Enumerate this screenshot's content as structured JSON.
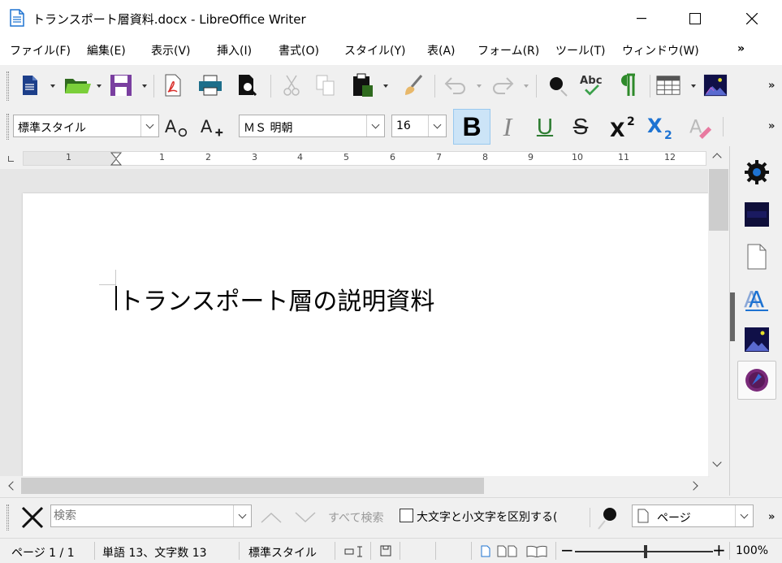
{
  "window": {
    "title": "トランスポート層資料.docx - LibreOffice Writer",
    "minimize": "—",
    "maximize": "☐",
    "close": "✕"
  },
  "menu": [
    "ファイル(F)",
    "編集(E)",
    "表示(V)",
    "挿入(I)",
    "書式(O)",
    "スタイル(Y)",
    "表(A)",
    "フォーム(R)",
    "ツール(T)",
    "ウィンドウ(W)"
  ],
  "menu_more": "»",
  "toolbar_more": "»",
  "formatting": {
    "paragraph_style": "標準スタイル",
    "font_name": "ＭＳ 明朝",
    "font_size": "16",
    "bold": "B",
    "italic": "I",
    "underline": "U",
    "strike": "S"
  },
  "ruler": {
    "marks": [
      "1",
      "1",
      "2",
      "3",
      "4",
      "5",
      "6",
      "7",
      "8",
      "9",
      "10",
      "11",
      "12"
    ]
  },
  "document": {
    "heading": "トランスポート層の説明資料"
  },
  "findbar": {
    "placeholder": "検索",
    "find_all": "すべて検索",
    "match_case": "大文字と小文字を区別する(",
    "nav_target": "ページ"
  },
  "status": {
    "page": "ページ 1 / 1",
    "words": "単語 13、文字数 13",
    "style": "標準スタイル",
    "zoom": "100%",
    "zoom_level": 1.0
  },
  "colors": {
    "accent": "#1e73d2",
    "underline": "#2e7d32",
    "save_purple": "#7a3fa0",
    "folder_green": "#7bcf3a"
  }
}
